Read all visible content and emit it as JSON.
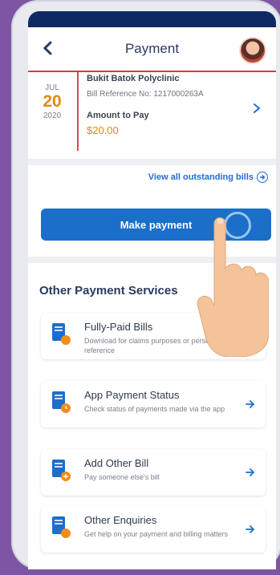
{
  "header": {
    "title": "Payment",
    "back_icon": "chevron-left-icon",
    "avatar": "avatar"
  },
  "bill": {
    "month": "JUL",
    "day": "20",
    "year": "2020",
    "clinic": "Bukit Batok Polyclinic",
    "reference": "Bill Reference No: 1217000263A",
    "amount_label": "Amount to Pay",
    "amount": "$20.00"
  },
  "view_all": "View all outstanding bills",
  "make_payment": "Make payment",
  "other_services_title": "Other Payment Services",
  "services": [
    {
      "name": "Fully-Paid Bills",
      "desc": "Download for claims purposes or personal reference"
    },
    {
      "name": "App Payment Status",
      "desc": "Check status of payments made via the app"
    },
    {
      "name": "Add Other Bill",
      "desc": "Pay someone else's bill"
    },
    {
      "name": "Other Enquiries",
      "desc": "Get help on your payment and billing matters"
    }
  ],
  "colors": {
    "primary": "#1b6fc9",
    "accent": "#e08a12",
    "navy": "#0f2a63",
    "frame": "#7d55a3"
  }
}
